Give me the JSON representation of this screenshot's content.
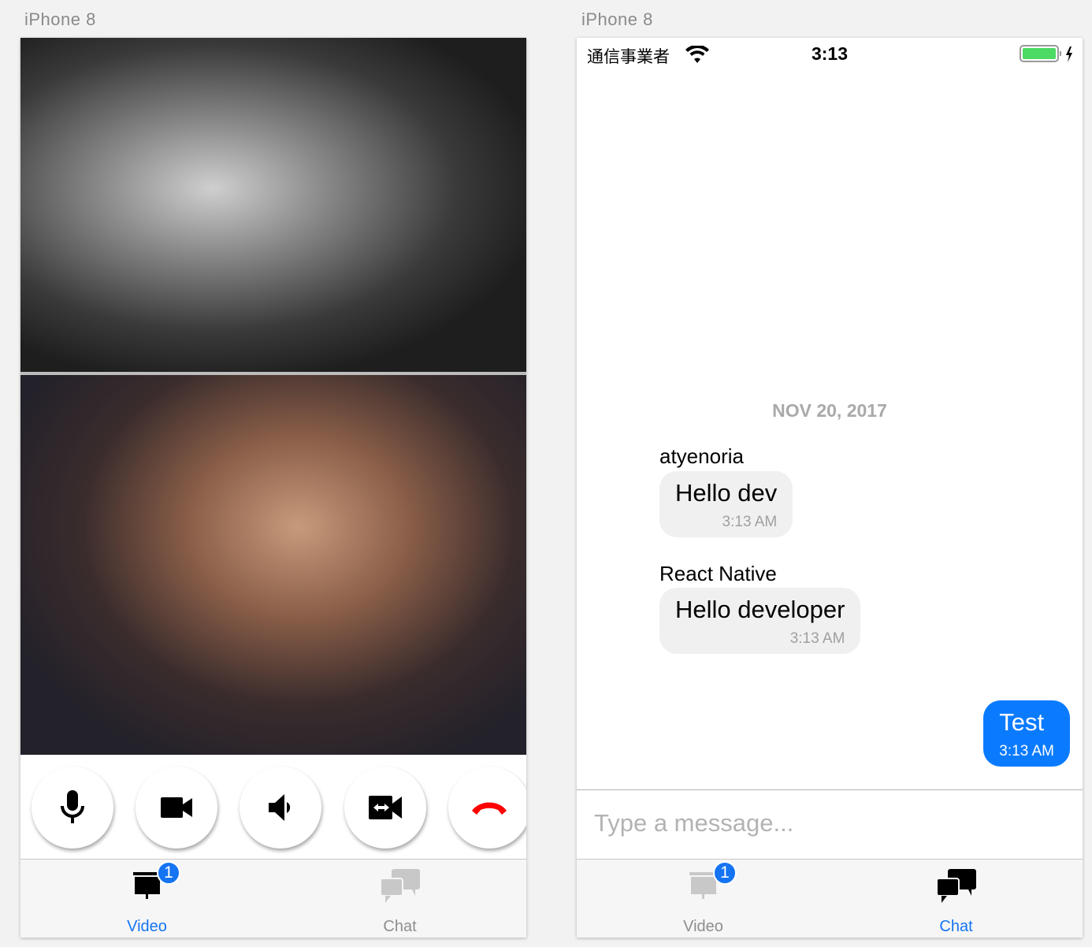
{
  "left": {
    "device_label": "iPhone 8",
    "controls": [
      {
        "icon": "microphone-icon"
      },
      {
        "icon": "video-camera-icon"
      },
      {
        "icon": "speaker-icon"
      },
      {
        "icon": "switch-camera-icon"
      },
      {
        "icon": "hang-up-icon",
        "color": "#ff0000"
      }
    ],
    "tabs": [
      {
        "label": "Video",
        "active": true,
        "badge": "1"
      },
      {
        "label": "Chat",
        "active": false
      }
    ]
  },
  "right": {
    "device_label": "iPhone 8",
    "status": {
      "carrier": "通信事業者",
      "time": "3:13",
      "battery_color": "#4cd964"
    },
    "date_separator": "NOV 20, 2017",
    "messages": [
      {
        "user": "atyenoria",
        "text": "Hello dev",
        "time": "3:13 AM"
      },
      {
        "user": "React Native",
        "text": "Hello developer",
        "time": "3:13 AM"
      },
      {
        "user": "",
        "text": "Test",
        "time": "3:13 AM",
        "mine": true
      }
    ],
    "input": {
      "placeholder": "Type a message..."
    },
    "tabs": [
      {
        "label": "Video",
        "active": false,
        "badge": "1"
      },
      {
        "label": "Chat",
        "active": true
      }
    ]
  },
  "colors": {
    "accent": "#1474f2",
    "inactive": "#8e8e8e"
  }
}
